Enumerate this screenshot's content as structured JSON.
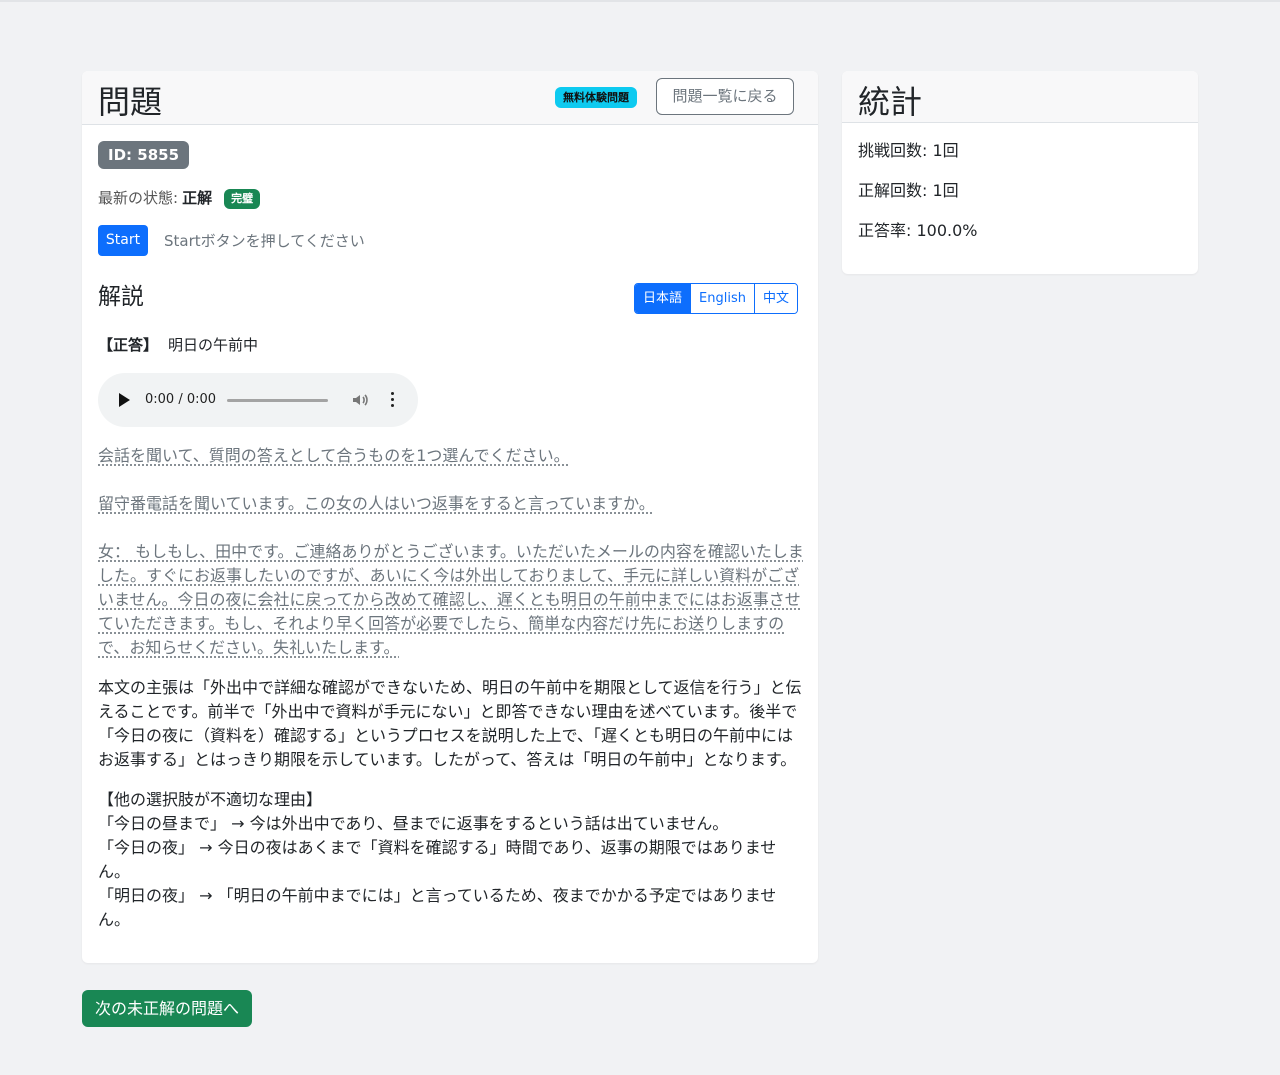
{
  "problem": {
    "title": "問題",
    "trial_badge": "無料体験問題",
    "back_button": "問題一覧に戻る",
    "id_label": "ID: 5855",
    "status_label": "最新の状態:",
    "status_value": "正解",
    "perfect_badge": "完璧",
    "start_button": "Start",
    "start_message": "Startボタンを押してください",
    "explanation_title": "解説",
    "languages": [
      "日本語",
      "English",
      "中文"
    ],
    "active_language": "日本語",
    "answer_label": "【正答】",
    "answer_value": "明日の午前中",
    "audio_time": "0:00 / 0:00",
    "instruction": "会話を聞いて、質問の答えとして合うものを1つ選んでください。",
    "question": "留守番電話を聞いています。この女の人はいつ返事をすると言っていますか。",
    "transcript": "女： もしもし、田中です。ご連絡ありがとうございます。いただいたメールの内容を確認いたしました。すぐにお返事したいのですが、あいにく今は外出しておりまして、手元に詳しい資料がございません。今日の夜に会社に戻ってから改めて確認し、遅くとも明日の午前中までにはお返事させていただきます。もし、それより早く回答が必要でしたら、簡単な内容だけ先にお送りしますので、お知らせください。失礼いたします。",
    "explanation": "本文の主張は「外出中で詳細な確認ができないため、明日の午前中を期限として返信を行う」と伝えることです。前半で「外出中で資料が手元にない」と即答できない理由を述べています。後半で「今日の夜に（資料を）確認する」というプロセスを説明した上で、「遅くとも明日の午前中にはお返事する」とはっきり期限を示しています。したがって、答えは「明日の午前中」となります。",
    "others_title": "【他の選択肢が不適切な理由】",
    "others": [
      "「今日の昼まで」 → 今は外出中であり、昼までに返事をするという話は出ていません。",
      "「今日の夜」 → 今日の夜はあくまで「資料を確認する」時間であり、返事の期限ではありません。",
      "「明日の夜」 → 「明日の午前中までには」と言っているため、夜までかかる予定ではありません。"
    ]
  },
  "stats": {
    "title": "統計",
    "attempts": "挑戦回数: 1回",
    "correct": "正解回数: 1回",
    "rate": "正答率: 100.0%"
  },
  "next_button": "次の未正解の問題へ"
}
